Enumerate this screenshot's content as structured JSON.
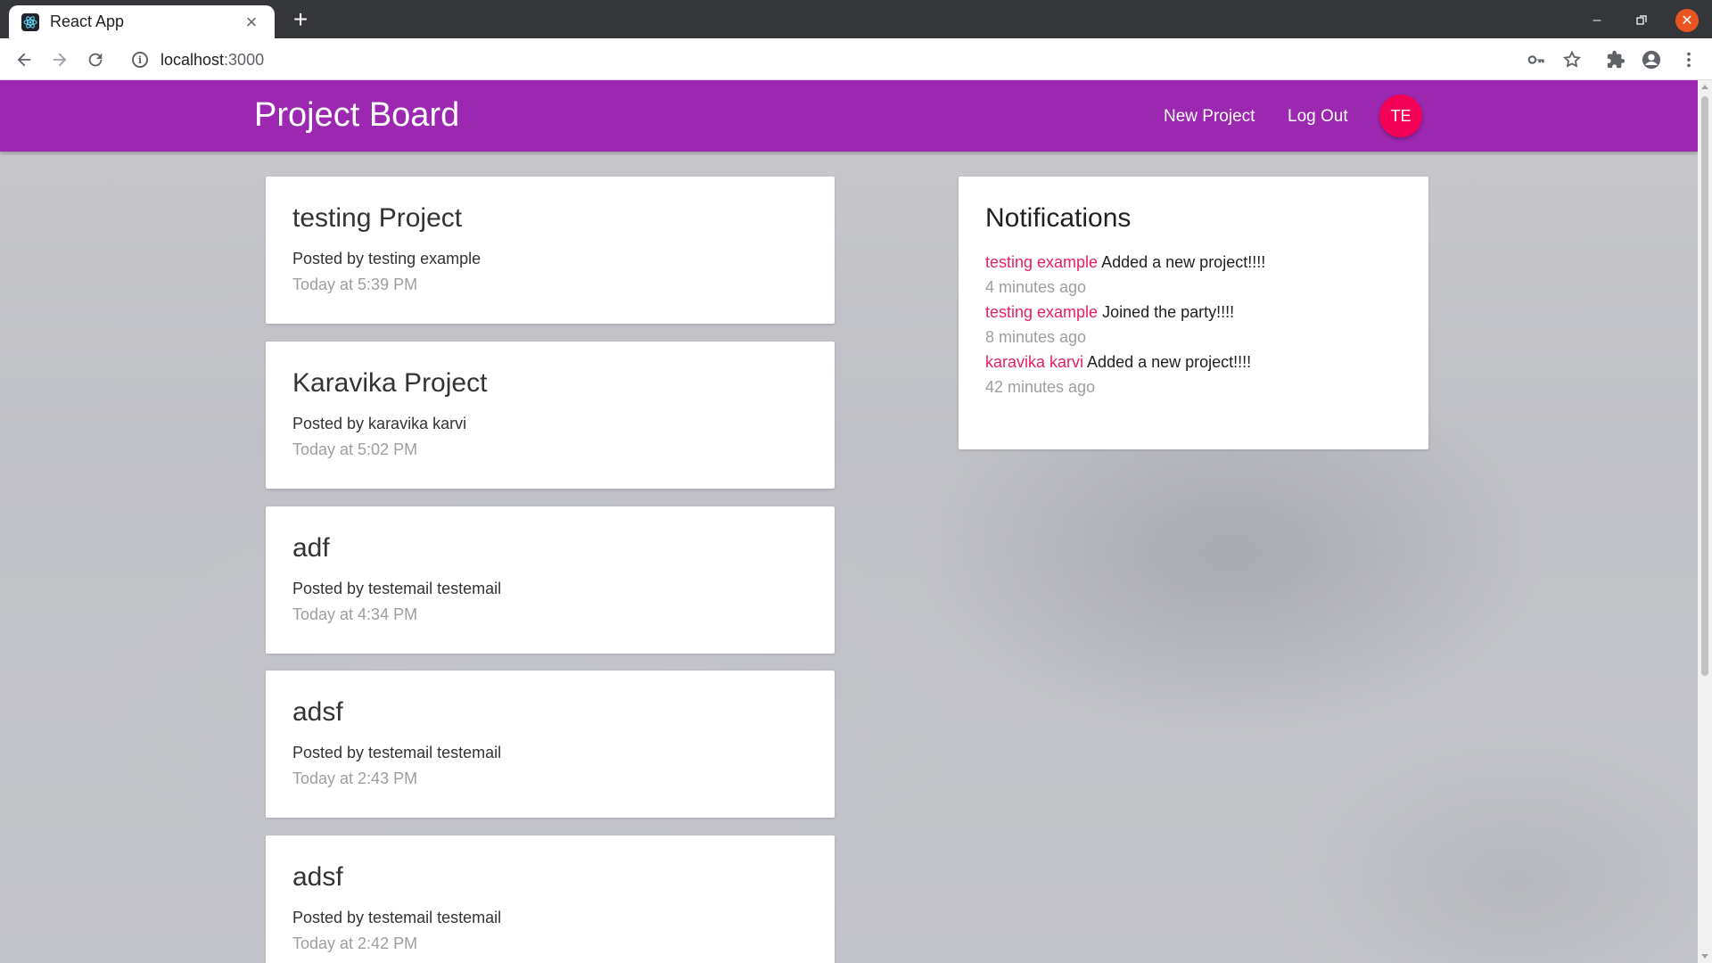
{
  "browser": {
    "tab_title": "React App",
    "url_host": "localhost",
    "url_port": ":3000"
  },
  "appbar": {
    "title": "Project Board",
    "new_project": "New Project",
    "log_out": "Log Out",
    "avatar_initials": "TE"
  },
  "projects": [
    {
      "title": "testing Project",
      "author": "Posted by testing example",
      "time": "Today at 5:39 PM"
    },
    {
      "title": "Karavika Project",
      "author": "Posted by karavika karvi",
      "time": "Today at 5:02 PM"
    },
    {
      "title": "adf",
      "author": "Posted by testemail testemail",
      "time": "Today at 4:34 PM"
    },
    {
      "title": "adsf",
      "author": "Posted by testemail testemail",
      "time": "Today at 2:43 PM"
    },
    {
      "title": "adsf",
      "author": "Posted by testemail testemail",
      "time": "Today at 2:42 PM"
    }
  ],
  "notifications": {
    "heading": "Notifications",
    "items": [
      {
        "user": "testing example",
        "message": "Added a new project!!!!",
        "time": "4 minutes ago"
      },
      {
        "user": "testing example",
        "message": "Joined the party!!!!",
        "time": "8 minutes ago"
      },
      {
        "user": "karavika karvi",
        "message": "Added a new project!!!!",
        "time": "42 minutes ago"
      }
    ]
  },
  "colors": {
    "appbar": "#9c27b0",
    "avatar": "#f50057",
    "notif_user": "#e91e63",
    "window_close": "#e95420"
  }
}
